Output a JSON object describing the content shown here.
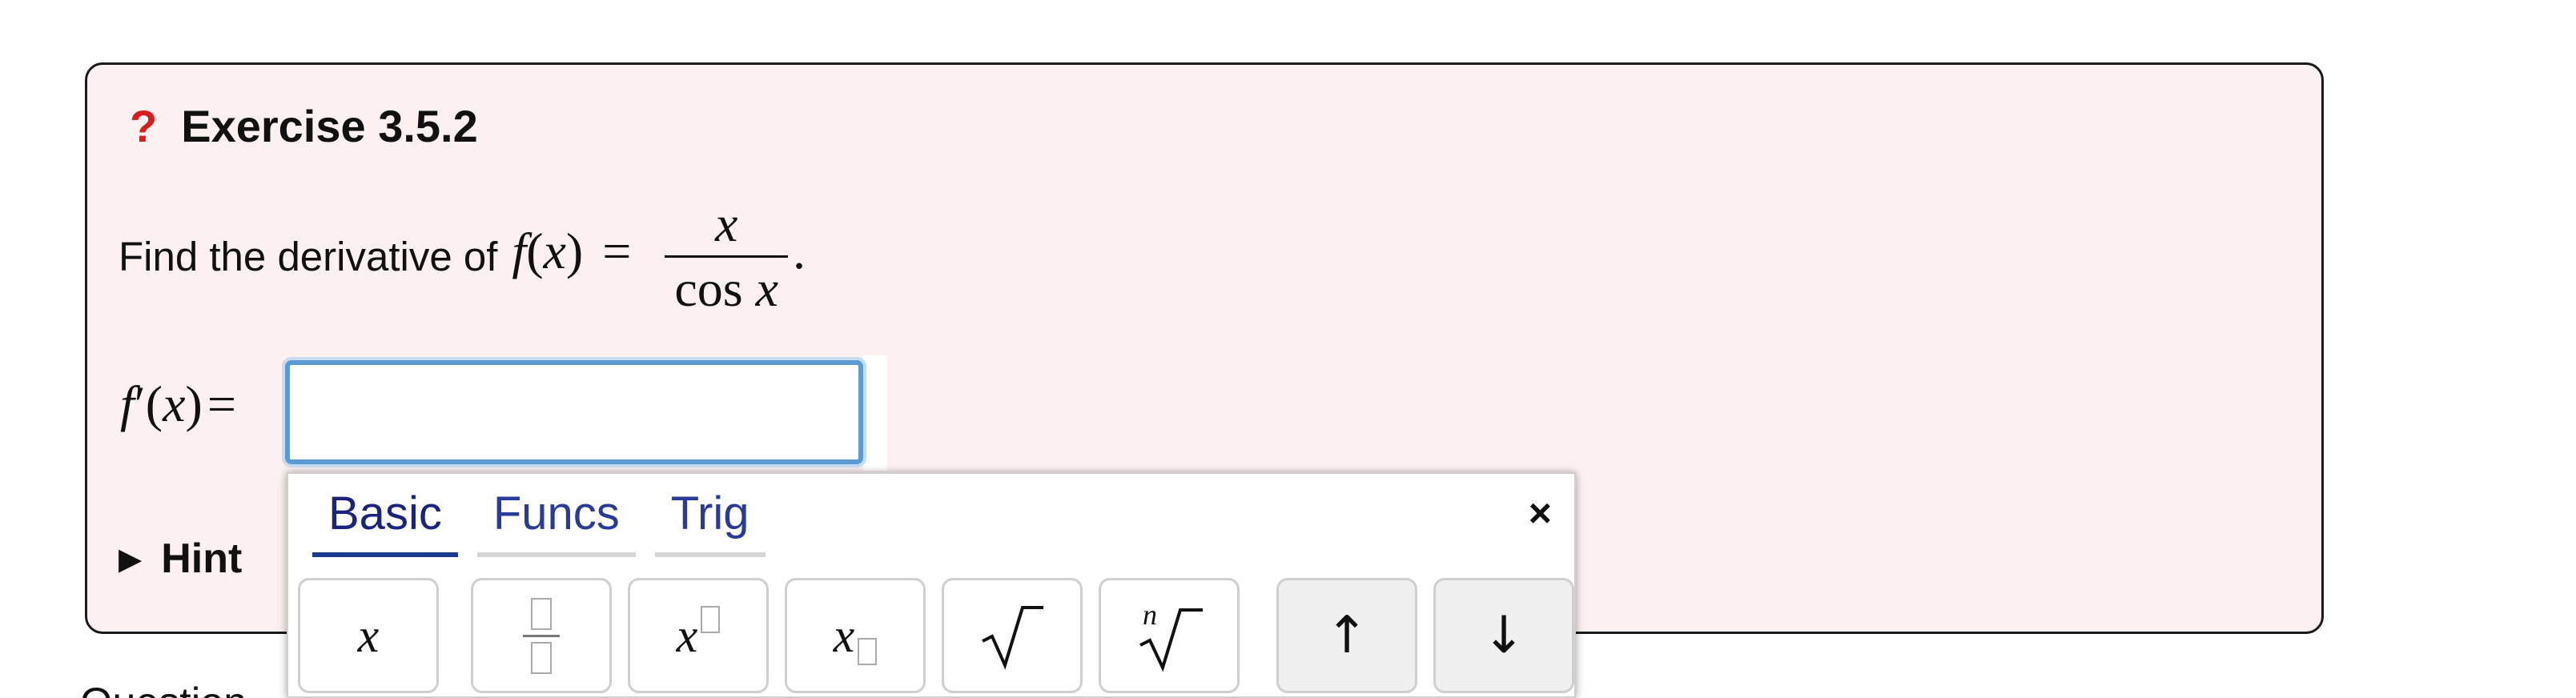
{
  "exercise": {
    "question_icon": "?",
    "title": "Exercise 3.5.2"
  },
  "prompt": {
    "text": "Find the derivative of",
    "func_name": "f",
    "func_var": "x",
    "equals": "=",
    "numerator": "x",
    "denominator_fn": "cos",
    "denominator_var": "x",
    "period": "."
  },
  "answer": {
    "label_fn": "f",
    "label_prime": "′",
    "label_var": "x",
    "equals": "=",
    "value": "",
    "placeholder": ""
  },
  "hint": {
    "arrow": "▶",
    "label": "Hint"
  },
  "below": {
    "partial_text": "Question"
  },
  "keypad": {
    "tabs": [
      {
        "label": "Basic",
        "active": true
      },
      {
        "label": "Funcs",
        "active": false
      },
      {
        "label": "Trig",
        "active": false
      }
    ],
    "close_label": "×",
    "keys": {
      "x": "x",
      "power_base": "x",
      "subscript_base": "x",
      "nroot_index": "n",
      "up": "↑",
      "down": "↓"
    }
  },
  "colors": {
    "box_background": "#fcf0f0",
    "question_mark": "#d81b1b",
    "input_focus": "#5b9bd5",
    "tab_active": "#1a237e",
    "tab_text": "#2a3a9a"
  }
}
